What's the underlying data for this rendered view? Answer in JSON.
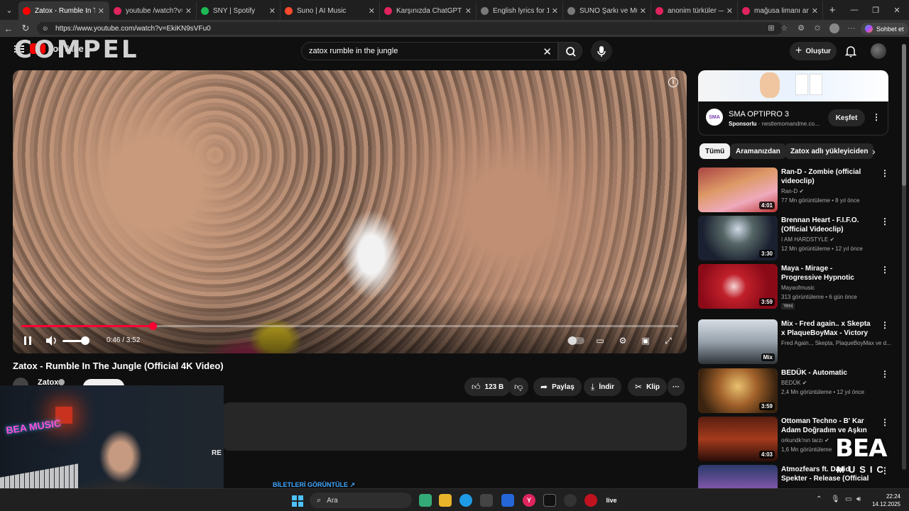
{
  "browser": {
    "tabs": [
      {
        "label": "Zatox - Rumble In T",
        "color": "#ff0000",
        "active": true
      },
      {
        "label": "youtube /watch?v=nd_d",
        "color": "#e0245e",
        "active": false
      },
      {
        "label": "SNY | Spotify",
        "color": "#1db954",
        "active": false
      },
      {
        "label": "Suno | AI Music",
        "color": "#ff4a2e",
        "active": false
      },
      {
        "label": "Karşınızda ChatGPT | Op",
        "color": "#e0245e",
        "active": false
      },
      {
        "label": "English lyrics for 120 BP",
        "color": "#7a7a7a",
        "active": false
      },
      {
        "label": "SUNO Şarkı ve Müzik St",
        "color": "#7a7a7a",
        "active": false
      },
      {
        "label": "anonim türküler — Yand",
        "color": "#e0245e",
        "active": false
      },
      {
        "label": "mağusa limanı anonim",
        "color": "#e0245e",
        "active": false
      }
    ],
    "url": "https://www.youtube.com/watch?v=EkiKN9sVFu0",
    "copilot_label": "Sohbet et"
  },
  "watermark": "COMPEL",
  "header": {
    "logo_text": "YouTube",
    "search_value": "zatox rumble in the jungle",
    "create_label": "Oluştur"
  },
  "player": {
    "progress_fraction": 0.2,
    "time_display": "0:46 / 3:52"
  },
  "video": {
    "title": "Zatox - Rumble In The Jungle (Official 4K Video)",
    "channel": "Zatox",
    "likes": "123 B",
    "share_label": "Paylaş",
    "download_label": "İndir",
    "clip_label": "Klip",
    "tickets_label": "BİLETLERİ GÖRÜNTÜLE ↗"
  },
  "webcam": {
    "sign_text": "BEA MUSIC",
    "side_text": "RE"
  },
  "ad": {
    "logo": "SMA",
    "title": "SMA OPTIPRO 3",
    "sponsored": "Sponsorlu",
    "domain": "nestlemomandme.co...",
    "cta": "Keşfet"
  },
  "chips": [
    "Tümü",
    "Aramanızdan",
    "Zatox adlı yükleyiciden"
  ],
  "recommendations": [
    {
      "title": "Ran-D - Zombie (official videoclip)",
      "channel": "Ran-D",
      "verified": true,
      "meta": "77 Mn görüntüleme • 8 yıl önce",
      "duration": "4:01",
      "thumb": "linear-gradient(160deg,#a44 0%,#d96 40%,#eab 70%,#b33 100%)",
      "badge": ""
    },
    {
      "title": "Brennan Heart - F.I.F.O. (Official Videoclip)",
      "channel": "I AM HARDSTYLE",
      "verified": true,
      "meta": "12 Mn görüntüleme • 12 yıl önce",
      "duration": "3:30",
      "thumb": "radial-gradient(circle at 50% 30%,#cfd8e6 0%,#566 30%,#1b2030 70%)",
      "badge": ""
    },
    {
      "title": "Maya - Mirage - Progressive Hypnotic Techno Music",
      "channel": "Mayaofmusic",
      "verified": false,
      "meta": "313 görüntüleme • 6 gün önce",
      "duration": "3:59",
      "thumb": "radial-gradient(circle at 45% 50%,#f4d4d4 0%,#c0202a 25%,#8a0a18 70%)",
      "badge": "Yeni"
    },
    {
      "title": "Mix - Fred again.. x Skepta x PlaqueBoyMax - Victory Lap ...",
      "channel": "Fred Again.., Skepta, PlaqueBoyMax ve d...",
      "verified": false,
      "meta": "",
      "duration": "Mix",
      "thumb": "linear-gradient(180deg,#d8dde4 0%,#98a2ad 50%,#2e3338 100%)",
      "badge": ""
    },
    {
      "title": "BEDÜK - Automatic",
      "channel": "BEDÜK",
      "verified": true,
      "meta": "2,4 Mn görüntüleme • 12 yıl önce",
      "duration": "3:59",
      "thumb": "radial-gradient(circle at 50% 40%,#e8c070 0%,#a0602a 40%,#3a2410 80%)",
      "badge": ""
    },
    {
      "title": "Ottoman Techno - B' Kar Adam Doğradım ve Aşkın",
      "channel": "orkundk'nın tarzı",
      "verified": true,
      "meta": "1,6 Mn görüntüleme",
      "duration": "4:03",
      "thumb": "linear-gradient(180deg,#5a1e10 0%,#a43a1c 50%,#2a0e08 100%)",
      "badge": ""
    },
    {
      "title": "Atmozfears ft. David Spekter - Release (Official Videoclip)",
      "channel": "",
      "verified": false,
      "meta": "",
      "duration": "",
      "thumb": "linear-gradient(180deg,#2a3a6a 0%,#8a5ab0 60%,#111 100%)",
      "badge": ""
    }
  ],
  "overlay_brand": {
    "big": "BEA",
    "small": "MUSIC"
  },
  "taskbar": {
    "search_label": "Ara",
    "time": "22:24",
    "date": "14.12.2025"
  }
}
